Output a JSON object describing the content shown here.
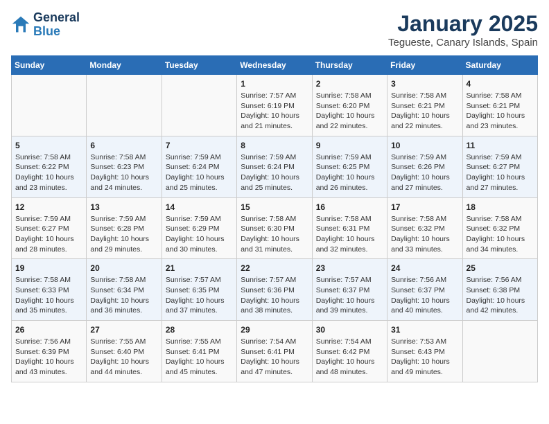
{
  "header": {
    "logo_line1": "General",
    "logo_line2": "Blue",
    "month": "January 2025",
    "location": "Tegueste, Canary Islands, Spain"
  },
  "days_of_week": [
    "Sunday",
    "Monday",
    "Tuesday",
    "Wednesday",
    "Thursday",
    "Friday",
    "Saturday"
  ],
  "weeks": [
    {
      "cells": [
        {
          "day": "",
          "info": ""
        },
        {
          "day": "",
          "info": ""
        },
        {
          "day": "",
          "info": ""
        },
        {
          "day": "1",
          "info": "Sunrise: 7:57 AM\nSunset: 6:19 PM\nDaylight: 10 hours\nand 21 minutes."
        },
        {
          "day": "2",
          "info": "Sunrise: 7:58 AM\nSunset: 6:20 PM\nDaylight: 10 hours\nand 22 minutes."
        },
        {
          "day": "3",
          "info": "Sunrise: 7:58 AM\nSunset: 6:21 PM\nDaylight: 10 hours\nand 22 minutes."
        },
        {
          "day": "4",
          "info": "Sunrise: 7:58 AM\nSunset: 6:21 PM\nDaylight: 10 hours\nand 23 minutes."
        }
      ]
    },
    {
      "cells": [
        {
          "day": "5",
          "info": "Sunrise: 7:58 AM\nSunset: 6:22 PM\nDaylight: 10 hours\nand 23 minutes."
        },
        {
          "day": "6",
          "info": "Sunrise: 7:58 AM\nSunset: 6:23 PM\nDaylight: 10 hours\nand 24 minutes."
        },
        {
          "day": "7",
          "info": "Sunrise: 7:59 AM\nSunset: 6:24 PM\nDaylight: 10 hours\nand 25 minutes."
        },
        {
          "day": "8",
          "info": "Sunrise: 7:59 AM\nSunset: 6:24 PM\nDaylight: 10 hours\nand 25 minutes."
        },
        {
          "day": "9",
          "info": "Sunrise: 7:59 AM\nSunset: 6:25 PM\nDaylight: 10 hours\nand 26 minutes."
        },
        {
          "day": "10",
          "info": "Sunrise: 7:59 AM\nSunset: 6:26 PM\nDaylight: 10 hours\nand 27 minutes."
        },
        {
          "day": "11",
          "info": "Sunrise: 7:59 AM\nSunset: 6:27 PM\nDaylight: 10 hours\nand 27 minutes."
        }
      ]
    },
    {
      "cells": [
        {
          "day": "12",
          "info": "Sunrise: 7:59 AM\nSunset: 6:27 PM\nDaylight: 10 hours\nand 28 minutes."
        },
        {
          "day": "13",
          "info": "Sunrise: 7:59 AM\nSunset: 6:28 PM\nDaylight: 10 hours\nand 29 minutes."
        },
        {
          "day": "14",
          "info": "Sunrise: 7:59 AM\nSunset: 6:29 PM\nDaylight: 10 hours\nand 30 minutes."
        },
        {
          "day": "15",
          "info": "Sunrise: 7:58 AM\nSunset: 6:30 PM\nDaylight: 10 hours\nand 31 minutes."
        },
        {
          "day": "16",
          "info": "Sunrise: 7:58 AM\nSunset: 6:31 PM\nDaylight: 10 hours\nand 32 minutes."
        },
        {
          "day": "17",
          "info": "Sunrise: 7:58 AM\nSunset: 6:32 PM\nDaylight: 10 hours\nand 33 minutes."
        },
        {
          "day": "18",
          "info": "Sunrise: 7:58 AM\nSunset: 6:32 PM\nDaylight: 10 hours\nand 34 minutes."
        }
      ]
    },
    {
      "cells": [
        {
          "day": "19",
          "info": "Sunrise: 7:58 AM\nSunset: 6:33 PM\nDaylight: 10 hours\nand 35 minutes."
        },
        {
          "day": "20",
          "info": "Sunrise: 7:58 AM\nSunset: 6:34 PM\nDaylight: 10 hours\nand 36 minutes."
        },
        {
          "day": "21",
          "info": "Sunrise: 7:57 AM\nSunset: 6:35 PM\nDaylight: 10 hours\nand 37 minutes."
        },
        {
          "day": "22",
          "info": "Sunrise: 7:57 AM\nSunset: 6:36 PM\nDaylight: 10 hours\nand 38 minutes."
        },
        {
          "day": "23",
          "info": "Sunrise: 7:57 AM\nSunset: 6:37 PM\nDaylight: 10 hours\nand 39 minutes."
        },
        {
          "day": "24",
          "info": "Sunrise: 7:56 AM\nSunset: 6:37 PM\nDaylight: 10 hours\nand 40 minutes."
        },
        {
          "day": "25",
          "info": "Sunrise: 7:56 AM\nSunset: 6:38 PM\nDaylight: 10 hours\nand 42 minutes."
        }
      ]
    },
    {
      "cells": [
        {
          "day": "26",
          "info": "Sunrise: 7:56 AM\nSunset: 6:39 PM\nDaylight: 10 hours\nand 43 minutes."
        },
        {
          "day": "27",
          "info": "Sunrise: 7:55 AM\nSunset: 6:40 PM\nDaylight: 10 hours\nand 44 minutes."
        },
        {
          "day": "28",
          "info": "Sunrise: 7:55 AM\nSunset: 6:41 PM\nDaylight: 10 hours\nand 45 minutes."
        },
        {
          "day": "29",
          "info": "Sunrise: 7:54 AM\nSunset: 6:41 PM\nDaylight: 10 hours\nand 47 minutes."
        },
        {
          "day": "30",
          "info": "Sunrise: 7:54 AM\nSunset: 6:42 PM\nDaylight: 10 hours\nand 48 minutes."
        },
        {
          "day": "31",
          "info": "Sunrise: 7:53 AM\nSunset: 6:43 PM\nDaylight: 10 hours\nand 49 minutes."
        },
        {
          "day": "",
          "info": ""
        }
      ]
    }
  ]
}
